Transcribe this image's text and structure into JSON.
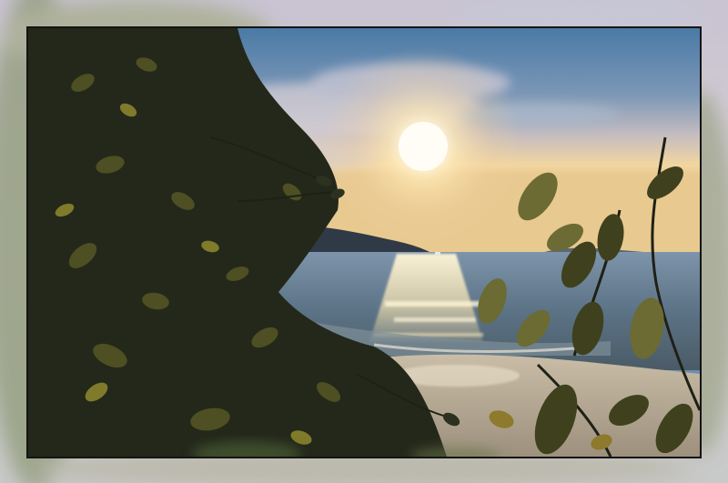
{
  "scene": {
    "subject": "sunset-over-bay",
    "colors": {
      "sky_top": "#4f7ea8",
      "sky_mid": "#b9b7c6",
      "sky_horizon": "#f0cf95",
      "sun": "#fffaf0",
      "sun_glow": "#ffe7a8",
      "sea_far": "#6f8aa4",
      "sea_near": "#4e6272",
      "sand": "#b8ac99",
      "foliage_dark": "#1f2415",
      "foliage_light": "#6f6e2a",
      "mat": "#cfc8d2",
      "border": "#141414"
    }
  }
}
